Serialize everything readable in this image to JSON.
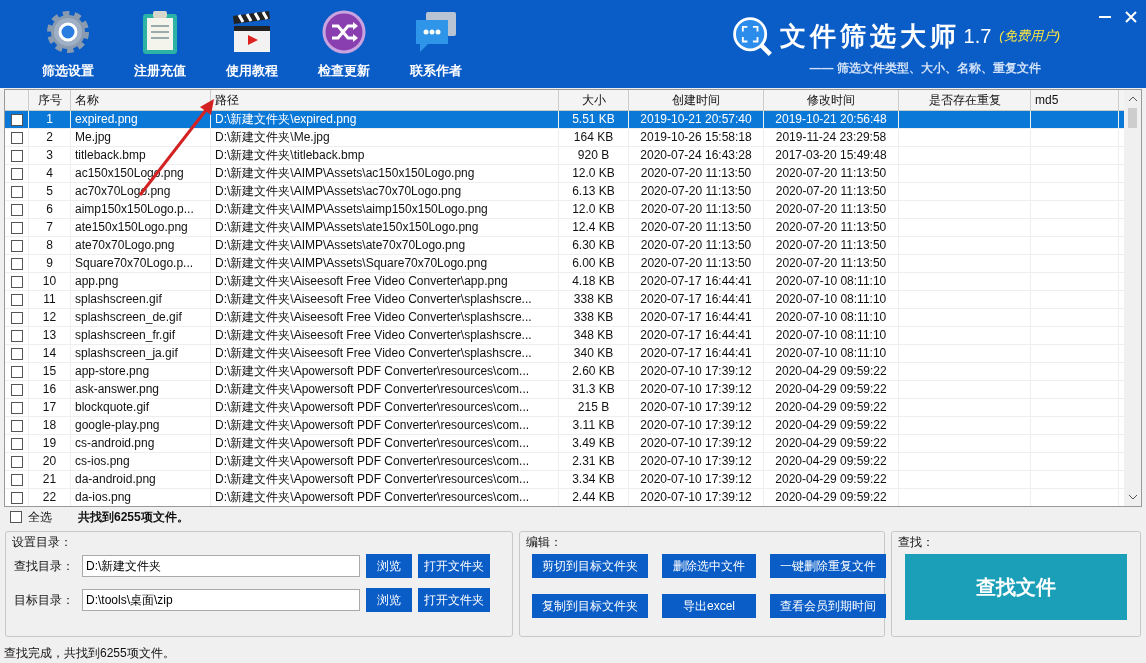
{
  "toolbar": [
    {
      "label": "筛选设置"
    },
    {
      "label": "注册充值"
    },
    {
      "label": "使用教程"
    },
    {
      "label": "检查更新"
    },
    {
      "label": "联系作者"
    }
  ],
  "app_title": "文件筛选大师",
  "version": "1.7",
  "edition": "(免费用户)",
  "subtitle": "—— 筛选文件类型、大小、名称、重复文件",
  "table": {
    "columns": [
      "序号",
      "名称",
      "路径",
      "大小",
      "创建时间",
      "修改时间",
      "是否存在重复",
      "md5"
    ],
    "rows": [
      {
        "checked": false,
        "selected": true,
        "index": "1",
        "name": "expired.png",
        "path": "D:\\新建文件夹\\expired.png",
        "size": "5.51 KB",
        "created": "2019-10-21 20:57:40",
        "modified": "2019-10-21 20:56:48"
      },
      {
        "checked": false,
        "selected": false,
        "index": "2",
        "name": "Me.jpg",
        "path": "D:\\新建文件夹\\Me.jpg",
        "size": "164 KB",
        "created": "2019-10-26 15:58:18",
        "modified": "2019-11-24 23:29:58"
      },
      {
        "checked": false,
        "selected": false,
        "index": "3",
        "name": "titleback.bmp",
        "path": "D:\\新建文件夹\\titleback.bmp",
        "size": "920 B",
        "created": "2020-07-24 16:43:28",
        "modified": "2017-03-20 15:49:48"
      },
      {
        "checked": false,
        "selected": false,
        "index": "4",
        "name": "ac150x150Logo.png",
        "path": "D:\\新建文件夹\\AIMP\\Assets\\ac150x150Logo.png",
        "size": "12.0 KB",
        "created": "2020-07-20 11:13:50",
        "modified": "2020-07-20 11:13:50"
      },
      {
        "checked": false,
        "selected": false,
        "index": "5",
        "name": "ac70x70Logo.png",
        "path": "D:\\新建文件夹\\AIMP\\Assets\\ac70x70Logo.png",
        "size": "6.13 KB",
        "created": "2020-07-20 11:13:50",
        "modified": "2020-07-20 11:13:50"
      },
      {
        "checked": false,
        "selected": false,
        "index": "6",
        "name": "aimp150x150Logo.p...",
        "path": "D:\\新建文件夹\\AIMP\\Assets\\aimp150x150Logo.png",
        "size": "12.0 KB",
        "created": "2020-07-20 11:13:50",
        "modified": "2020-07-20 11:13:50"
      },
      {
        "checked": false,
        "selected": false,
        "index": "7",
        "name": "ate150x150Logo.png",
        "path": "D:\\新建文件夹\\AIMP\\Assets\\ate150x150Logo.png",
        "size": "12.4 KB",
        "created": "2020-07-20 11:13:50",
        "modified": "2020-07-20 11:13:50"
      },
      {
        "checked": false,
        "selected": false,
        "index": "8",
        "name": "ate70x70Logo.png",
        "path": "D:\\新建文件夹\\AIMP\\Assets\\ate70x70Logo.png",
        "size": "6.30 KB",
        "created": "2020-07-20 11:13:50",
        "modified": "2020-07-20 11:13:50"
      },
      {
        "checked": false,
        "selected": false,
        "index": "9",
        "name": "Square70x70Logo.p...",
        "path": "D:\\新建文件夹\\AIMP\\Assets\\Square70x70Logo.png",
        "size": "6.00 KB",
        "created": "2020-07-20 11:13:50",
        "modified": "2020-07-20 11:13:50"
      },
      {
        "checked": false,
        "selected": false,
        "index": "10",
        "name": "app.png",
        "path": "D:\\新建文件夹\\Aiseesoft Free Video Converter\\app.png",
        "size": "4.18 KB",
        "created": "2020-07-17 16:44:41",
        "modified": "2020-07-10 08:11:10"
      },
      {
        "checked": false,
        "selected": false,
        "index": "11",
        "name": "splashscreen.gif",
        "path": "D:\\新建文件夹\\Aiseesoft Free Video Converter\\splashscre...",
        "size": "338 KB",
        "created": "2020-07-17 16:44:41",
        "modified": "2020-07-10 08:11:10"
      },
      {
        "checked": false,
        "selected": false,
        "index": "12",
        "name": "splashscreen_de.gif",
        "path": "D:\\新建文件夹\\Aiseesoft Free Video Converter\\splashscre...",
        "size": "338 KB",
        "created": "2020-07-17 16:44:41",
        "modified": "2020-07-10 08:11:10"
      },
      {
        "checked": false,
        "selected": false,
        "index": "13",
        "name": "splashscreen_fr.gif",
        "path": "D:\\新建文件夹\\Aiseesoft Free Video Converter\\splashscre...",
        "size": "348 KB",
        "created": "2020-07-17 16:44:41",
        "modified": "2020-07-10 08:11:10"
      },
      {
        "checked": false,
        "selected": false,
        "index": "14",
        "name": "splashscreen_ja.gif",
        "path": "D:\\新建文件夹\\Aiseesoft Free Video Converter\\splashscre...",
        "size": "340 KB",
        "created": "2020-07-17 16:44:41",
        "modified": "2020-07-10 08:11:10"
      },
      {
        "checked": false,
        "selected": false,
        "index": "15",
        "name": "app-store.png",
        "path": "D:\\新建文件夹\\Apowersoft PDF Converter\\resources\\com...",
        "size": "2.60 KB",
        "created": "2020-07-10 17:39:12",
        "modified": "2020-04-29 09:59:22"
      },
      {
        "checked": false,
        "selected": false,
        "index": "16",
        "name": "ask-answer.png",
        "path": "D:\\新建文件夹\\Apowersoft PDF Converter\\resources\\com...",
        "size": "31.3 KB",
        "created": "2020-07-10 17:39:12",
        "modified": "2020-04-29 09:59:22"
      },
      {
        "checked": false,
        "selected": false,
        "index": "17",
        "name": "blockquote.gif",
        "path": "D:\\新建文件夹\\Apowersoft PDF Converter\\resources\\com...",
        "size": "215 B",
        "created": "2020-07-10 17:39:12",
        "modified": "2020-04-29 09:59:22"
      },
      {
        "checked": false,
        "selected": false,
        "index": "18",
        "name": "google-play.png",
        "path": "D:\\新建文件夹\\Apowersoft PDF Converter\\resources\\com...",
        "size": "3.11 KB",
        "created": "2020-07-10 17:39:12",
        "modified": "2020-04-29 09:59:22"
      },
      {
        "checked": false,
        "selected": false,
        "index": "19",
        "name": "cs-android.png",
        "path": "D:\\新建文件夹\\Apowersoft PDF Converter\\resources\\com...",
        "size": "3.49 KB",
        "created": "2020-07-10 17:39:12",
        "modified": "2020-04-29 09:59:22"
      },
      {
        "checked": false,
        "selected": false,
        "index": "20",
        "name": "cs-ios.png",
        "path": "D:\\新建文件夹\\Apowersoft PDF Converter\\resources\\com...",
        "size": "2.31 KB",
        "created": "2020-07-10 17:39:12",
        "modified": "2020-04-29 09:59:22"
      },
      {
        "checked": false,
        "selected": false,
        "index": "21",
        "name": "da-android.png",
        "path": "D:\\新建文件夹\\Apowersoft PDF Converter\\resources\\com...",
        "size": "3.34 KB",
        "created": "2020-07-10 17:39:12",
        "modified": "2020-04-29 09:59:22"
      },
      {
        "checked": false,
        "selected": false,
        "index": "22",
        "name": "da-ios.png",
        "path": "D:\\新建文件夹\\Apowersoft PDF Converter\\resources\\com...",
        "size": "2.44 KB",
        "created": "2020-07-10 17:39:12",
        "modified": "2020-04-29 09:59:22"
      }
    ]
  },
  "select_all": {
    "label": "全选",
    "checked": false
  },
  "found_count": "共找到6255项文件。",
  "directory_panel": {
    "title": "设置目录：",
    "fields": [
      {
        "label": "查找目录：",
        "value": "D:\\新建文件夹",
        "buttons": [
          "浏览",
          "打开文件夹"
        ]
      },
      {
        "label": "目标目录：",
        "value": "D:\\tools\\桌面\\zip",
        "buttons": [
          "浏览",
          "打开文件夹"
        ]
      }
    ]
  },
  "edit_panel": {
    "title": "编辑：",
    "buttons": [
      "剪切到目标文件夹",
      "删除选中文件",
      "一键删除重复文件",
      "复制到目标文件夹",
      "导出excel",
      "查看会员到期时间"
    ]
  },
  "search_panel": {
    "title": "查找：",
    "button": "查找文件"
  },
  "status_bar": "查找完成，共找到6255项文件。"
}
